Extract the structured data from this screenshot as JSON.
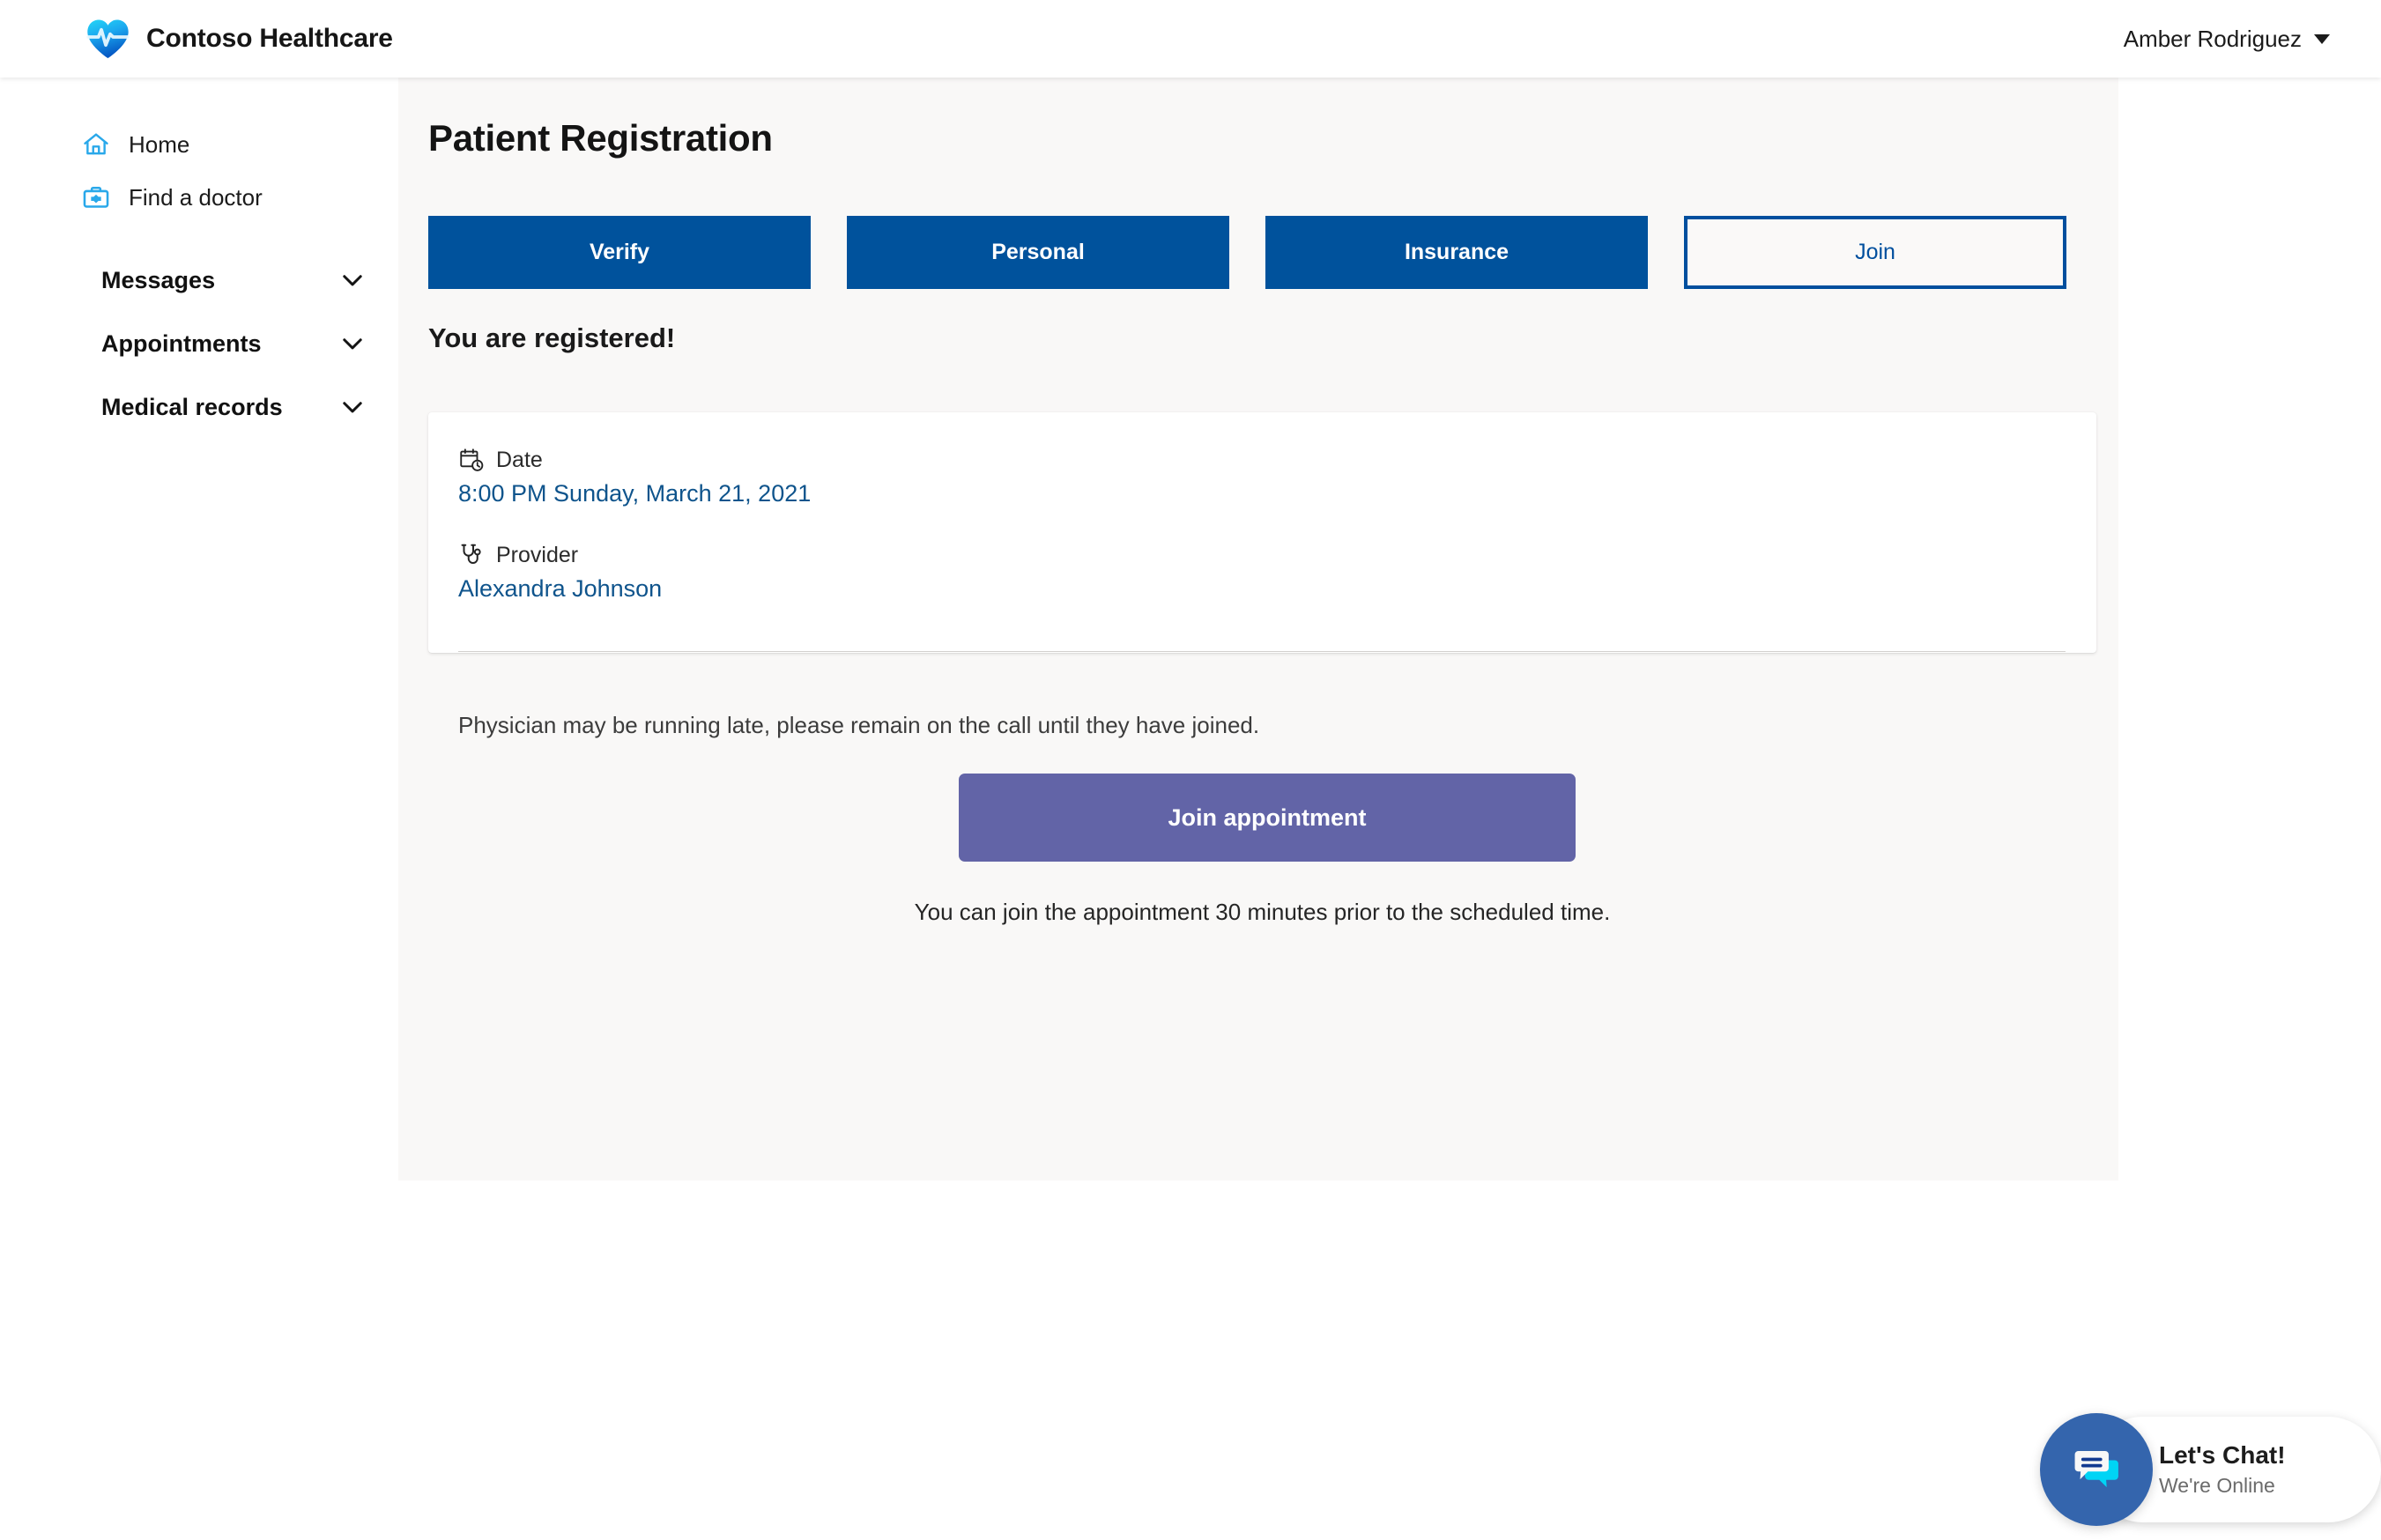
{
  "header": {
    "brand_name": "Contoso Healthcare",
    "logo_icon": "heart-pulse-logo",
    "user_name": "Amber Rodriguez",
    "caret_icon": "chevron-down-icon"
  },
  "sidebar": {
    "links": [
      {
        "label": "Home",
        "icon": "home-icon"
      },
      {
        "label": "Find a doctor",
        "icon": "medical-bag-icon"
      }
    ],
    "groups": [
      {
        "label": "Messages",
        "icon": "chevron-down-icon"
      },
      {
        "label": "Appointments",
        "icon": "chevron-down-icon"
      },
      {
        "label": "Medical records",
        "icon": "chevron-down-icon"
      }
    ]
  },
  "main": {
    "page_title": "Patient Registration",
    "steps": [
      {
        "label": "Verify",
        "active": false
      },
      {
        "label": "Personal",
        "active": false
      },
      {
        "label": "Insurance",
        "active": false
      },
      {
        "label": "Join",
        "active": true
      }
    ],
    "confirmation_heading": "You are registered!",
    "card": {
      "date_label": "Date",
      "date_icon": "calendar-clock-icon",
      "date_value": "8:00 PM Sunday, March 21, 2021",
      "provider_label": "Provider",
      "provider_icon": "stethoscope-icon",
      "provider_value": "Alexandra Johnson",
      "late_note": "Physician may be running late, please remain on the call until they have joined.",
      "join_button_label": "Join appointment",
      "join_hint": "You can join the appointment 30 minutes prior to the scheduled time."
    }
  },
  "chat_widget": {
    "icon": "chat-bubbles-icon",
    "title": "Let's Chat!",
    "subtitle": "We're Online"
  },
  "colors": {
    "step_blue": "#00529c",
    "step_active_border": "#004f9e",
    "link_blue": "#0f548c",
    "join_purple": "#6264a7",
    "sidebar_icon_blue": "#29a8ea",
    "chat_circle_blue": "#3465ad",
    "chat_bubble_cyan": "#00d4f5",
    "page_bg": "#f9f8f7"
  }
}
